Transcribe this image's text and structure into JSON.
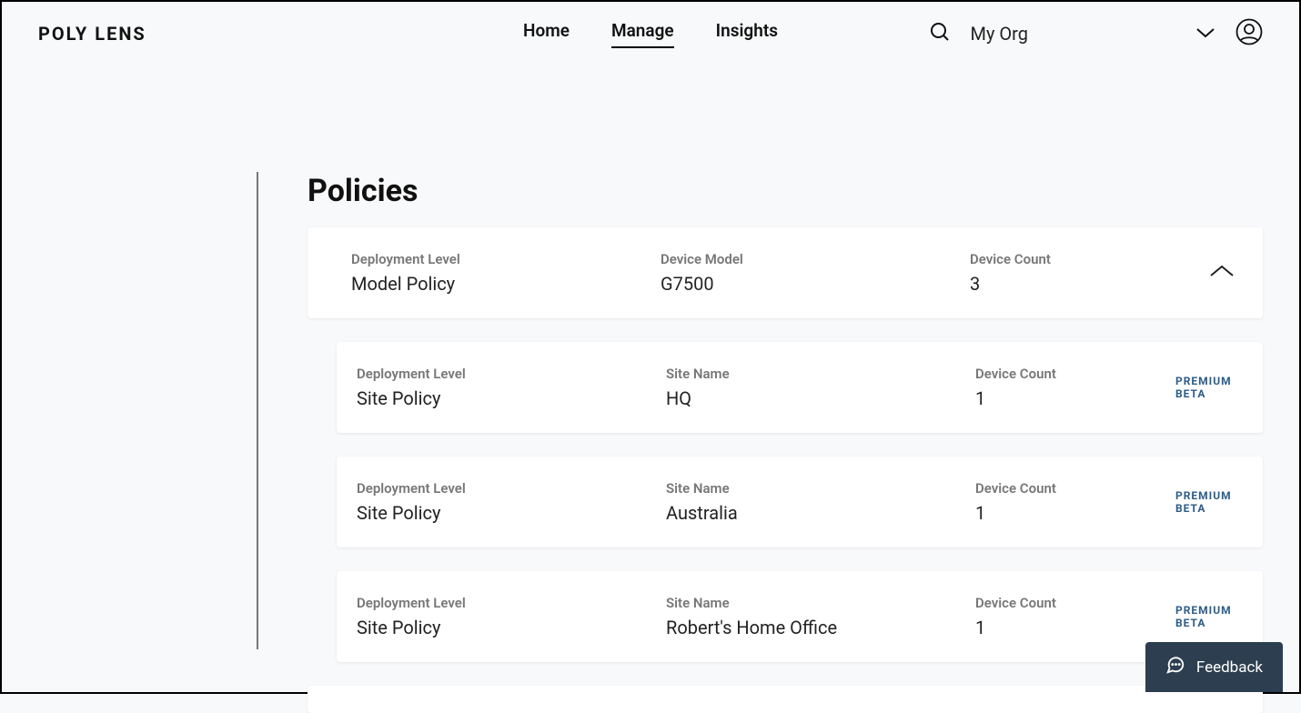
{
  "header": {
    "logo": "POLY LENS",
    "nav": [
      "Home",
      "Manage",
      "Insights"
    ],
    "org_label": "My Org"
  },
  "page": {
    "title": "Policies"
  },
  "labels": {
    "deployment_level": "Deployment Level",
    "device_model": "Device Model",
    "site_name": "Site Name",
    "device_count": "Device Count",
    "premium_beta": "PREMIUM BETA"
  },
  "policies": {
    "parent": {
      "deployment_level": "Model Policy",
      "device_model": "G7500",
      "device_count": "3"
    },
    "children": [
      {
        "deployment_level": "Site Policy",
        "site_name": "HQ",
        "device_count": "1"
      },
      {
        "deployment_level": "Site Policy",
        "site_name": "Australia",
        "device_count": "1"
      },
      {
        "deployment_level": "Site Policy",
        "site_name": "Robert's Home Office",
        "device_count": "1"
      }
    ]
  },
  "feedback": {
    "label": "Feedback"
  }
}
